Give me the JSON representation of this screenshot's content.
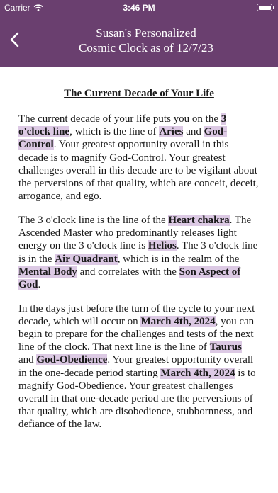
{
  "status_bar": {
    "carrier": "Carrier",
    "time": "3:46 PM"
  },
  "nav": {
    "title_line1": "Susan's Personalized",
    "title_line2": "Cosmic Clock as of 12/7/23",
    "back_icon": "chevron-left-icon"
  },
  "content": {
    "heading": "The Current Decade of Your Life",
    "p1": [
      "The current decade of your life puts you on the ",
      "3 o'clock line",
      ", which is the line of ",
      "Aries",
      " and ",
      "God-Control",
      ".  Your greatest opportunity overall in this decade is to magnify God-Control.  Your greatest challenges overall in this decade are to be vigilant about the perversions of that quality, which are conceit, deceit, arrogance, and ego."
    ],
    "p2": [
      "The 3 o'clock line is the line of the ",
      "Heart chakra",
      ". The Ascended Master who predominantly releases light energy on the 3 o'clock line is ",
      "Helios",
      ".  The 3 o'clock line is in the ",
      "Air Quadrant",
      ", which is in the realm of the ",
      "Mental Body",
      " and correlates with the ",
      "Son Aspect of God",
      "."
    ],
    "p3": [
      "In the days just before the turn of the cycle to your next decade, which will occur on ",
      "March 4th, 2024",
      ", you can begin to prepare for the challenges and tests of the next line of the clock.  That next line is the line of ",
      "Taurus",
      " and ",
      "God-Obedience",
      ".  Your greatest opportunity overall in the one-decade period starting ",
      "March 4th, 2024",
      " is to magnify God-Obedience.  Your greatest challenges overall in that one-decade period are the perversions of that quality, which are disobedience, stubbornness, and defiance of the law."
    ]
  },
  "colors": {
    "header": "#6a3f6f",
    "highlight": "#dcc9e4"
  }
}
